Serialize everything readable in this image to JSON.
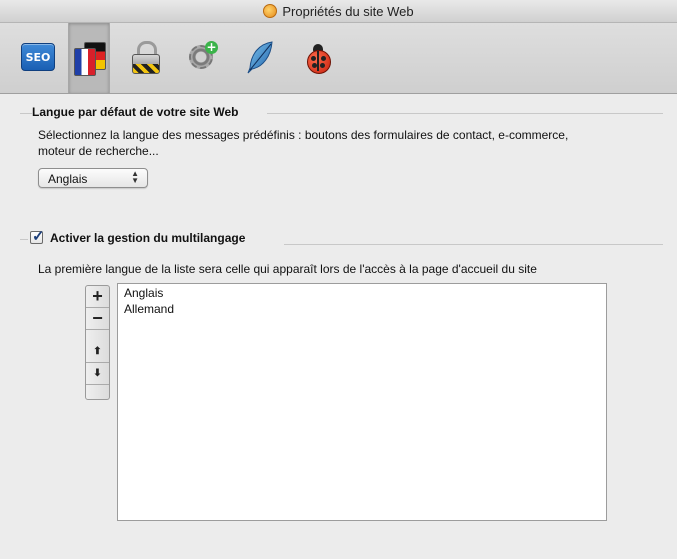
{
  "window": {
    "title": "Propriétés du site Web"
  },
  "toolbar": {
    "items": [
      {
        "name": "seo",
        "label": "SEO",
        "icon": "seo-icon",
        "selected": false
      },
      {
        "name": "language",
        "icon": "language-flags-icon",
        "selected": true
      },
      {
        "name": "security",
        "icon": "lock-icon",
        "selected": false
      },
      {
        "name": "settings",
        "icon": "gear-plus-icon",
        "selected": false
      },
      {
        "name": "design",
        "icon": "feather-icon",
        "selected": false
      },
      {
        "name": "debug",
        "icon": "ladybug-icon",
        "selected": false
      }
    ]
  },
  "default_language": {
    "heading": "Langue par défaut de votre site Web",
    "description_line1": "Sélectionnez la langue des messages prédéfinis : boutons des formulaires de contact, e-commerce,",
    "description_line2": "moteur de recherche...",
    "selected": "Anglais"
  },
  "multilanguage": {
    "checkbox_label": "Activer la gestion du multilangage",
    "checked": true,
    "description": "La première langue de la liste sera celle qui apparaît lors de l'accès à la page d'accueil du site",
    "languages": [
      "Anglais",
      "Allemand"
    ]
  },
  "list_controls": {
    "add": "+",
    "remove": "−",
    "up": "⬆",
    "down": "⬇"
  },
  "colors": {
    "accent": "#1a5fb3",
    "background": "#ececec"
  }
}
